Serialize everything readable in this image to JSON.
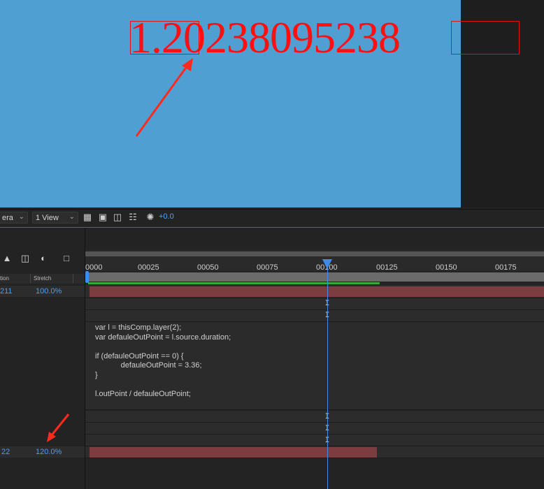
{
  "viewer": {
    "expression_output": "1.20238095238",
    "colors": {
      "canvas": "#4f9fd3",
      "text": "#ff0f0f",
      "annotation": "#ff2a1f"
    }
  },
  "toolbar": {
    "camera_dropdown": "era",
    "view_dropdown": "1 View",
    "icons": [
      "region-of-interest-icon",
      "snapshot-icon",
      "flowchart-icon",
      "network-icon",
      "exposure-reset-icon"
    ],
    "exposure_value": "+0.0"
  },
  "timeline": {
    "left_icons": [
      "layer-solo-icon",
      "comp-icon",
      "motion-blur-icon",
      "graph-editor-icon"
    ],
    "column_headers": [
      "tion",
      "Stretch"
    ],
    "rows": [
      {
        "col1": "211",
        "stretch": "100.0%"
      },
      {
        "col1": "22",
        "stretch": "120.0%"
      }
    ],
    "ruler_ticks": [
      "0000",
      "00025",
      "00050",
      "00075",
      "00100",
      "00125",
      "00150",
      "00175"
    ],
    "expression_code": "var l = thisComp.layer(2);\nvar defauleOutPoint = l.source.duration;\n\nif (defauleOutPoint == 0) {\n            defauleOutPoint = 3.36;\n}\n\nl.outPoint / defauleOutPoint;",
    "colors": {
      "cti": "#3f8be6",
      "layer_bar": "#7c3d40",
      "stretch_text": "#4d9ff2"
    }
  }
}
